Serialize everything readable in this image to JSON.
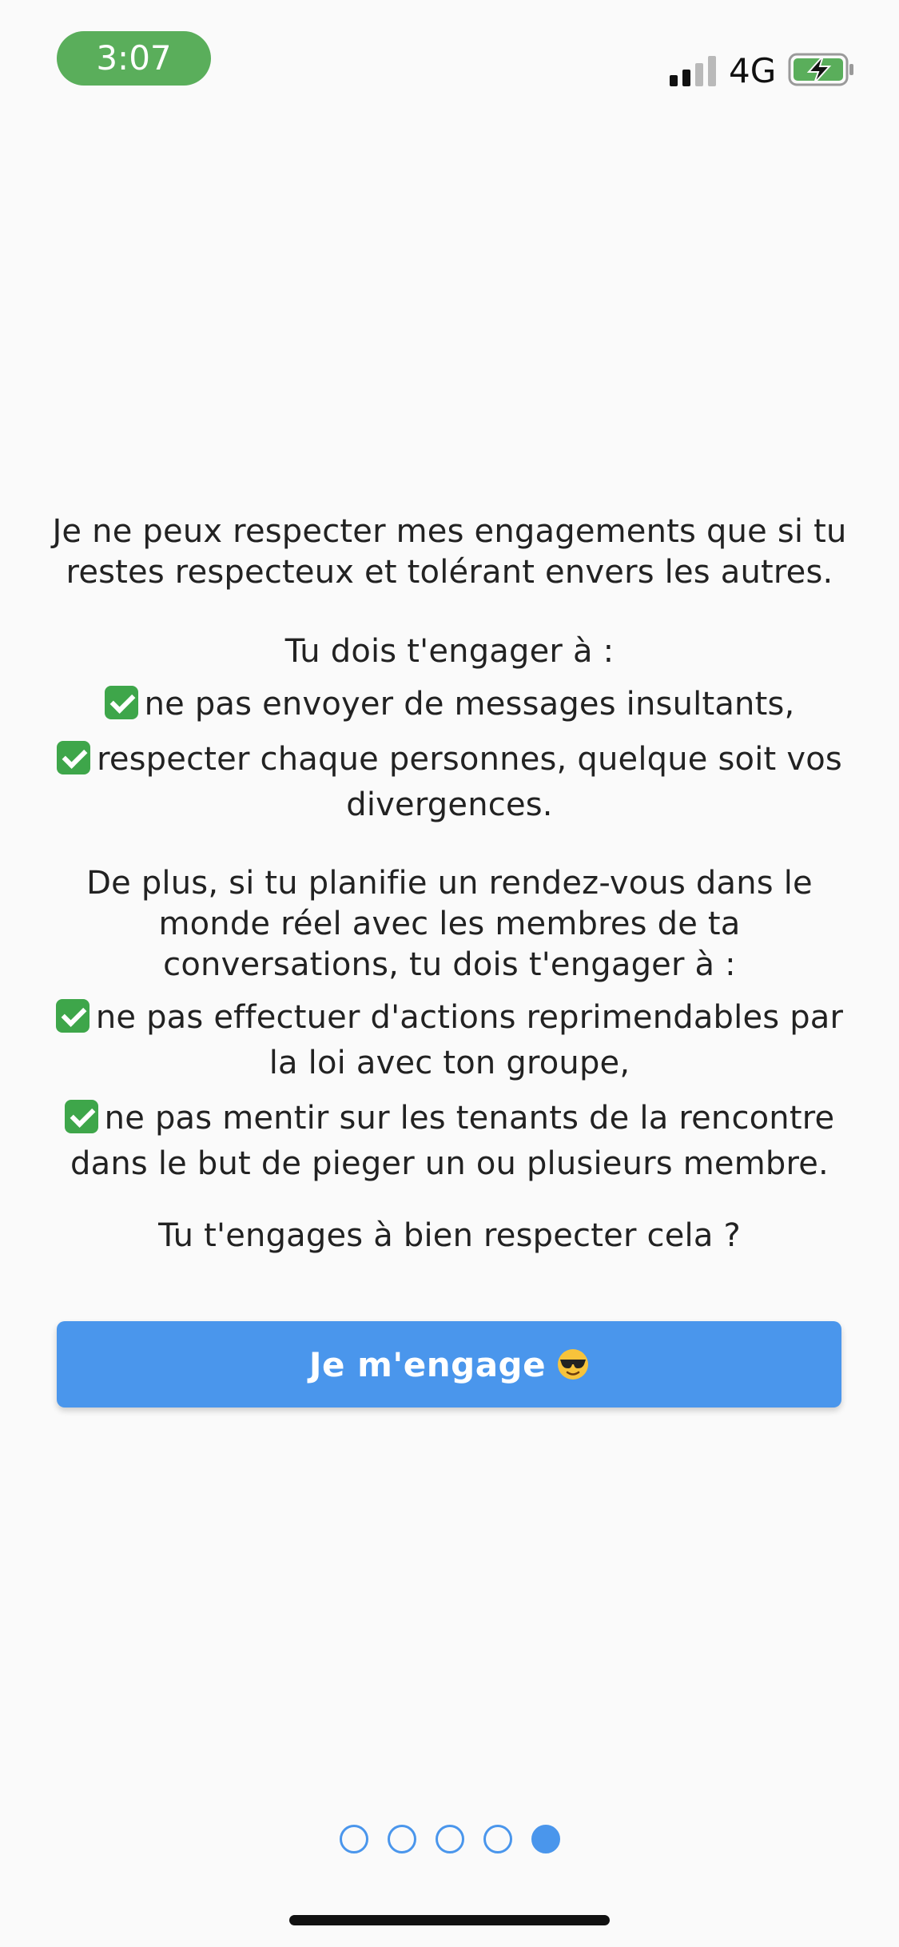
{
  "status_bar": {
    "time": "3:07",
    "network": "4G",
    "signal_bars_active": 2,
    "signal_bars_total": 4,
    "battery_state": "charging"
  },
  "content": {
    "intro": "Je ne peux respecter mes engagements que si tu restes respecteux et tolérant envers les autres.",
    "section1_title": "Tu dois t'engager à :",
    "section1_items": [
      "ne pas envoyer de messages insultants,",
      "respecter chaque personnes, quelque soit vos divergences."
    ],
    "section2_title": "De plus, si tu planifie un rendez-vous dans le monde réel avec les membres de ta conversations, tu dois t'engager à :",
    "section2_items": [
      "ne pas effectuer d'actions reprimendables par la loi avec ton groupe,",
      "ne pas mentir sur les tenants de la rencontre dans le but de pieger un ou plusieurs membre."
    ],
    "question": "Tu t'engages à bien respecter cela ?"
  },
  "button": {
    "label": "Je m'engage",
    "icon": "sunglasses-emoji"
  },
  "pagination": {
    "total": 5,
    "current": 5
  },
  "colors": {
    "accent": "#4a96ec",
    "time_pill": "#5aae5b",
    "check": "#3ea64a",
    "background": "#fafafa"
  }
}
